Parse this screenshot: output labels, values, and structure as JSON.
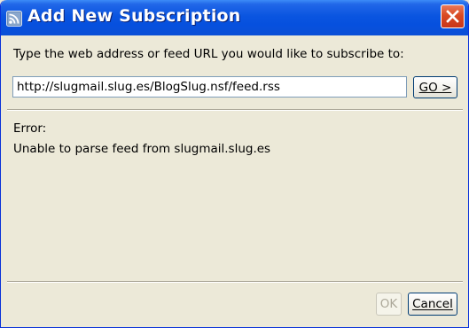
{
  "window": {
    "title": "Add New Subscription",
    "icon": "rss-feed-icon",
    "close_icon": "close-icon"
  },
  "form": {
    "prompt": "Type the web address or feed URL you would like to subscribe to:",
    "url_value": "http://slugmail.slug.es/BlogSlug.nsf/feed.rss",
    "go_label": "GO >"
  },
  "error": {
    "label": "Error:",
    "message": "Unable to parse feed from slugmail.slug.es"
  },
  "footer": {
    "ok_label": "OK",
    "cancel_label": "Cancel"
  },
  "colors": {
    "titlebar": "#0a55e0",
    "close_button": "#d94a23",
    "dialog_background": "#ece9d8"
  }
}
